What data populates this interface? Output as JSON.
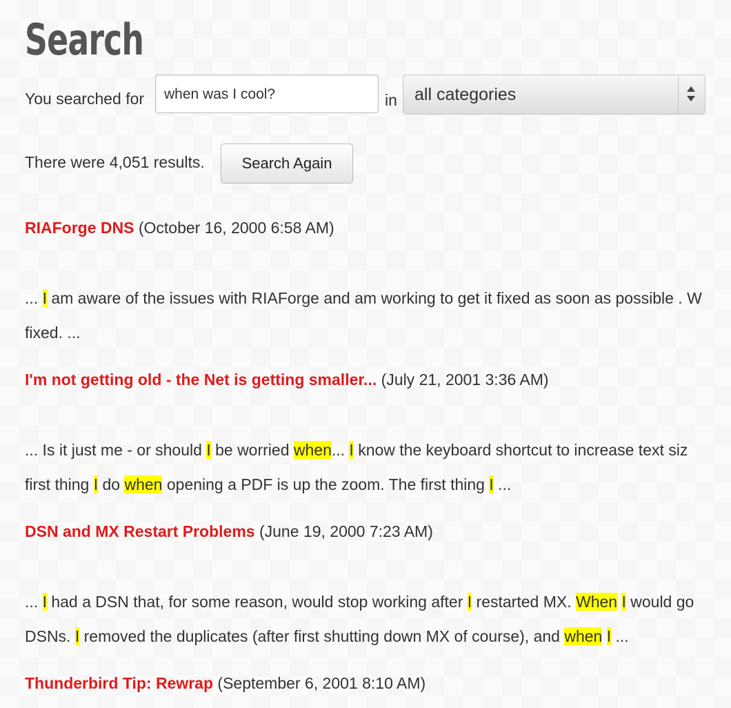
{
  "page": {
    "title": "Search"
  },
  "form": {
    "prefix": "You searched for",
    "query": "when was I cool?",
    "in_label": "in",
    "category": "all categories",
    "result_count_text": "There were 4,051 results.",
    "button_label": "Search Again"
  },
  "results": [
    {
      "title": "RIAForge DNS",
      "date": "(October 16, 2000 6:58 AM)",
      "snippet": [
        [
          {
            "t": "... "
          },
          {
            "t": "I",
            "hl": true
          },
          {
            "t": " am aware of the issues with RIAForge and am working to get it fixed as soon as possible . W"
          }
        ],
        [
          {
            "t": "fixed. ..."
          }
        ]
      ]
    },
    {
      "title": "I'm not getting old - the Net is getting smaller...",
      "date": "(July 21, 2001 3:36 AM)",
      "snippet": [
        [
          {
            "t": "... Is it just me - or should "
          },
          {
            "t": "I",
            "hl": true
          },
          {
            "t": " be worried "
          },
          {
            "t": "when",
            "hl": true
          },
          {
            "t": "... "
          },
          {
            "t": "I",
            "hl": true
          },
          {
            "t": " know the keyboard shortcut to increase text siz"
          }
        ],
        [
          {
            "t": "first thing "
          },
          {
            "t": "I",
            "hl": true
          },
          {
            "t": " do "
          },
          {
            "t": "when",
            "hl": true
          },
          {
            "t": " opening a PDF is up the zoom. The first thing "
          },
          {
            "t": "I",
            "hl": true
          },
          {
            "t": " ..."
          }
        ]
      ]
    },
    {
      "title": "DSN and MX Restart Problems",
      "date": "(June 19, 2000 7:23 AM)",
      "snippet": [
        [
          {
            "t": "... "
          },
          {
            "t": "I",
            "hl": true
          },
          {
            "t": " had a DSN that, for some reason, would stop working after "
          },
          {
            "t": "I",
            "hl": true
          },
          {
            "t": " restarted MX. "
          },
          {
            "t": "When",
            "hl": true
          },
          {
            "t": " "
          },
          {
            "t": "I",
            "hl": true
          },
          {
            "t": " would go"
          }
        ],
        [
          {
            "t": "DSNs. "
          },
          {
            "t": "I",
            "hl": true
          },
          {
            "t": " removed the duplicates (after first shutting down MX of course), and "
          },
          {
            "t": "when",
            "hl": true
          },
          {
            "t": " "
          },
          {
            "t": "I",
            "hl": true
          },
          {
            "t": " ..."
          }
        ]
      ]
    },
    {
      "title": "Thunderbird Tip: Rewrap",
      "date": "(September 6, 2001 8:10 AM)",
      "snippet": []
    }
  ]
}
